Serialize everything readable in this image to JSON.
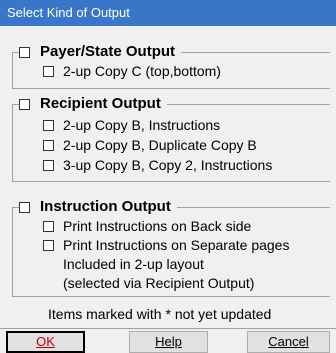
{
  "window": {
    "title": "Select Kind of Output"
  },
  "payer_group": {
    "label": "Payer/State Output",
    "options": [
      "2-up Copy C (top,bottom)"
    ]
  },
  "recipient_group": {
    "label": "Recipient Output",
    "options": [
      "2-up Copy B, Instructions",
      "2-up Copy B, Duplicate Copy B",
      "3-up Copy B, Copy 2, Instructions"
    ]
  },
  "instruction_group": {
    "label": "Instruction Output",
    "options": [
      "Print Instructions on Back side",
      "Print Instructions on Separate pages"
    ],
    "note_line1": "Included in 2-up layout",
    "note_line2": "(selected via Recipient Output)"
  },
  "footer": {
    "note": "Items marked with * not yet updated"
  },
  "buttons": {
    "ok": "OK",
    "help": "Help",
    "cancel": "Cancel"
  }
}
